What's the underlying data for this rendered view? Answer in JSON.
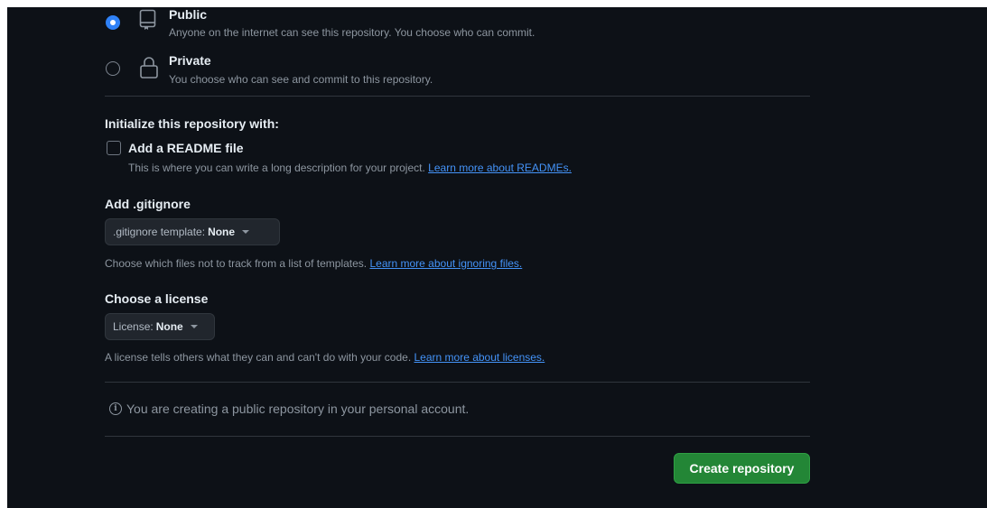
{
  "visibility": {
    "public": {
      "title": "Public",
      "description": "Anyone on the internet can see this repository. You choose who can commit.",
      "selected": true,
      "icon": "repo-icon"
    },
    "private": {
      "title": "Private",
      "description": "You choose who can see and commit to this repository.",
      "selected": false,
      "icon": "lock-icon"
    }
  },
  "initialize": {
    "heading": "Initialize this repository with:",
    "readme_label": "Add a README file",
    "readme_checked": false,
    "readme_desc": "This is where you can write a long description for your project.",
    "readme_link": "Learn more about READMEs."
  },
  "gitignore": {
    "heading": "Add .gitignore",
    "select_prefix": ".gitignore template:",
    "select_value": "None",
    "desc": "Choose which files not to track from a list of templates.",
    "link": "Learn more about ignoring files."
  },
  "license": {
    "heading": "Choose a license",
    "select_prefix": "License:",
    "select_value": "None",
    "desc": "A license tells others what they can and can't do with your code.",
    "link": "Learn more about licenses."
  },
  "notice": {
    "icon": "info-icon",
    "text": "You are creating a public repository in your personal account."
  },
  "create_button": "Create repository",
  "colors": {
    "background": "#0d1117",
    "accent_blue": "#2f81f7",
    "link": "#4493f8",
    "primary_button": "#238636"
  }
}
